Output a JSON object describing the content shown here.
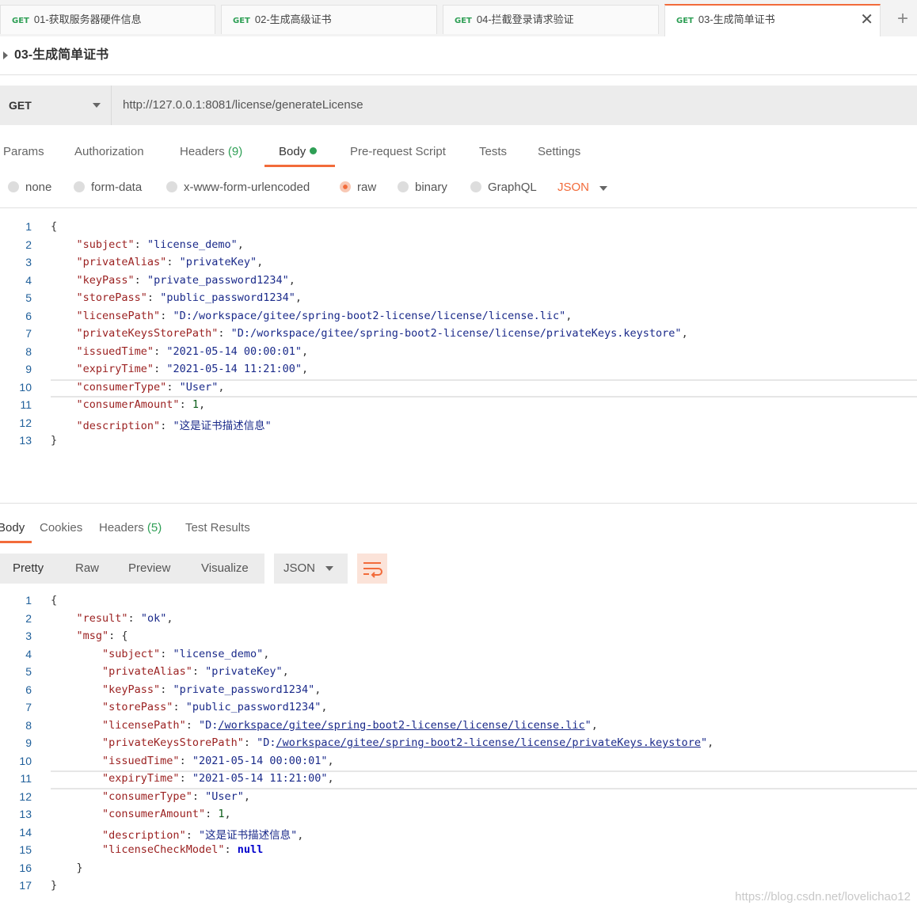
{
  "tabs": [
    {
      "method": "GET",
      "name": "01-获取服务器硬件信息"
    },
    {
      "method": "GET",
      "name": "02-生成高级证书"
    },
    {
      "method": "GET",
      "name": "04-拦截登录请求验证"
    },
    {
      "method": "GET",
      "name": "03-生成简单证书"
    }
  ],
  "tab_close": "✕",
  "tab_add": "+",
  "request_name": "03-生成简单证书",
  "request": {
    "method": "GET",
    "url": "http://127.0.0.1:8081/license/generateLicense"
  },
  "request_tabs": {
    "params": "Params",
    "authorization": "Authorization",
    "headers": "Headers",
    "headers_count": "(9)",
    "body": "Body",
    "prerequest": "Pre-request Script",
    "tests": "Tests",
    "settings": "Settings"
  },
  "body_types": {
    "none": "none",
    "form_data": "form-data",
    "urlencoded": "x-www-form-urlencoded",
    "raw": "raw",
    "binary": "binary",
    "graphql": "GraphQL",
    "format": "JSON"
  },
  "request_body_lines": [
    "{",
    "    \"subject\": \"license_demo\",",
    "    \"privateAlias\": \"privateKey\",",
    "    \"keyPass\": \"private_password1234\",",
    "    \"storePass\": \"public_password1234\",",
    "    \"licensePath\": \"D:/workspace/gitee/spring-boot2-license/license/license.lic\",",
    "    \"privateKeysStorePath\": \"D:/workspace/gitee/spring-boot2-license/license/privateKeys.keystore\",",
    "    \"issuedTime\": \"2021-05-14 00:00:01\",",
    "    \"expiryTime\": \"2021-05-14 11:21:00\",",
    "    \"consumerType\": \"User\",",
    "    \"consumerAmount\": 1,",
    "    \"description\": \"这是证书描述信息\"",
    "}"
  ],
  "response_tabs": {
    "body": "Body",
    "cookies": "Cookies",
    "headers": "Headers",
    "headers_count": "(5)",
    "test_results": "Test Results"
  },
  "response_view": {
    "pretty": "Pretty",
    "raw": "Raw",
    "preview": "Preview",
    "visualize": "Visualize",
    "format": "JSON"
  },
  "response_body_lines": [
    "{",
    "    \"result\": \"ok\",",
    "    \"msg\": {",
    "        \"subject\": \"license_demo\",",
    "        \"privateAlias\": \"privateKey\",",
    "        \"keyPass\": \"private_password1234\",",
    "        \"storePass\": \"public_password1234\",",
    "        \"licensePath\": \"D:/workspace/gitee/spring-boot2-license/license/license.lic\",",
    "        \"privateKeysStorePath\": \"D:/workspace/gitee/spring-boot2-license/license/privateKeys.keystore\",",
    "        \"issuedTime\": \"2021-05-14 00:00:01\",",
    "        \"expiryTime\": \"2021-05-14 11:21:00\",",
    "        \"consumerType\": \"User\",",
    "        \"consumerAmount\": 1,",
    "        \"description\": \"这是证书描述信息\",",
    "        \"licenseCheckModel\": null",
    "    }",
    "}"
  ],
  "watermark": "https://blog.csdn.net/lovelichao12",
  "colors": {
    "accent": "#f26b3a",
    "method_get": "#2e9f55",
    "key": "#9b2121",
    "string": "#1a2a8a"
  }
}
